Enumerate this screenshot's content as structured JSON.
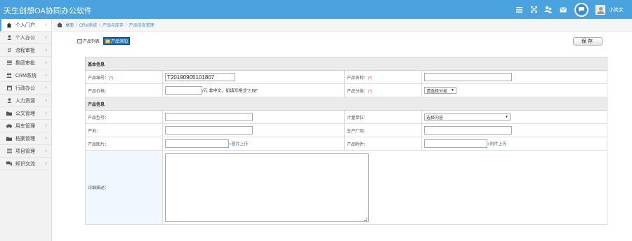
{
  "app": {
    "title": "天生创想OA协同办公软件",
    "username": "小笑女",
    "brand_color": "#4aa3df"
  },
  "top_icons": [
    "menu-icon",
    "fullscreen-icon",
    "user-group-icon",
    "mail-icon",
    "chat-icon"
  ],
  "sidebar": {
    "items": [
      {
        "label": "个人门户",
        "icon": "home-icon",
        "active": true
      },
      {
        "label": "个人办公",
        "icon": "user-icon"
      },
      {
        "label": "流程审批",
        "icon": "flow-icon"
      },
      {
        "label": "集团审批",
        "icon": "list-icon"
      },
      {
        "label": "CRM系统",
        "icon": "users-icon"
      },
      {
        "label": "行政办公",
        "icon": "calendar-icon"
      },
      {
        "label": "人力资源",
        "icon": "user-icon"
      },
      {
        "label": "公文管理",
        "icon": "folder-icon"
      },
      {
        "label": "用车管理",
        "icon": "car-icon"
      },
      {
        "label": "档案管理",
        "icon": "folder-icon"
      },
      {
        "label": "项目管理",
        "icon": "list-icon"
      },
      {
        "label": "知识交流",
        "icon": "comments-icon"
      }
    ]
  },
  "breadcrumb": [
    "桌面",
    "CRM系统",
    "产品与库存",
    "产品信息管理"
  ],
  "toolbar": {
    "list_label": "产品列表",
    "add_label": "产品添加",
    "save_label": "保存"
  },
  "form": {
    "section_basic": "基本信息",
    "section_product": "产品信息",
    "product_no_label": "产品编号：",
    "product_no_value": "T20190905101807",
    "product_name_label": "产品名称：",
    "price_label": "产品价格：",
    "price_hint": "/元 非中文，如填写格式\"2.68\"",
    "category_label": "产品分类：",
    "category_value": "请选择分类",
    "model_label": "产品型号：",
    "unit_label": "计量单位：",
    "unit_value": "选择内容",
    "origin_label": "产地：",
    "maker_label": "生产厂商：",
    "image_label": "产品图片：",
    "image_upload": "+图片上传",
    "attach_label": "产品附件：",
    "attach_upload": "+附件上传",
    "desc_label": "详细描述：",
    "required_mark": "(*)"
  }
}
